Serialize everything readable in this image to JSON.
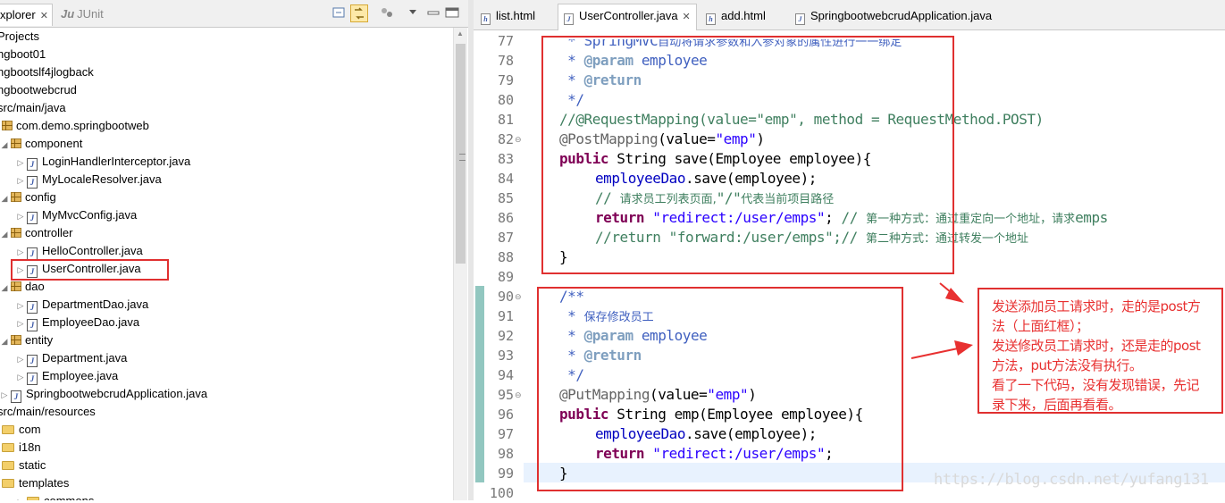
{
  "explorer": {
    "tab_label": "xplorer",
    "junit_label": "JUnit",
    "junit_icon": "Ju",
    "rows": [
      "Projects",
      "ngboot01",
      "ngbootslf4jlogback",
      "ngbootwebcrud",
      "src/main/java",
      "com.demo.springbootweb",
      "component",
      "LoginHandlerInterceptor.java",
      "MyLocaleResolver.java",
      "config",
      "MyMvcConfig.java",
      "controller",
      "HelloController.java",
      "UserController.java",
      "dao",
      "DepartmentDao.java",
      "EmployeeDao.java",
      "entity",
      "Department.java",
      "Employee.java",
      "SpringbootwebcrudApplication.java",
      "src/main/resources",
      "com",
      "i18n",
      "static",
      "templates",
      "commons"
    ]
  },
  "editor": {
    "tabs": [
      "list.html",
      "UserController.java",
      "add.html",
      "SpringbootwebcrudApplication.java"
    ],
    "line_numbers": [
      "77",
      "78",
      "79",
      "80",
      "81",
      "82",
      "83",
      "84",
      "85",
      "86",
      "87",
      "88",
      "89",
      "90",
      "91",
      "92",
      "93",
      "94",
      "95",
      "96",
      "97",
      "98",
      "99",
      "100"
    ],
    "code": {
      "l77a": " * SpringMVC",
      "l77b": "自动将请求参数和入参对象的属性进行一一绑定",
      "l78a": " * ",
      "l78b": "@param",
      "l78c": " employee",
      "l79a": " * ",
      "l79b": "@return",
      "l80": " */",
      "l81": "//@RequestMapping(value=\"emp\", method = RequestMethod.POST)",
      "l82a": "@PostMapping",
      "l82b": "(value=",
      "l82c": "\"emp\"",
      "l82d": ")",
      "l83a": "public",
      "l83b": " String save(Employee employee){",
      "l84a": "employeeDao",
      "l84b": ".save(employee);",
      "l85a": "// ",
      "l85b": "请求员工列表页面,",
      "l85c": "\"/\"",
      "l85d": "代表当前项目路径",
      "l86a": "return",
      "l86b": " \"redirect:/user/emps\"",
      "l86c": "; ",
      "l86d": "// ",
      "l86e": "第一种方式：通过重定向一个地址，请求",
      "l86f": "emps",
      "l87a": "//return \"forward:/user/emps\";// ",
      "l87b": "第二种方式：通过转发一个地址",
      "l88": "}",
      "l90": "/**",
      "l91a": " * ",
      "l91b": "保存修改员工",
      "l92a": " * ",
      "l92b": "@param",
      "l92c": " employee",
      "l93a": " * ",
      "l93b": "@return",
      "l94": " */",
      "l95a": "@PutMapping",
      "l95b": "(value=",
      "l95c": "\"emp\"",
      "l95d": ")",
      "l96a": "public",
      "l96b": " String emp(Employee employee){",
      "l97a": "employeeDao",
      "l97b": ".save(employee);",
      "l98a": "return",
      "l98b": " \"redirect:/user/emps\"",
      "l98c": ";",
      "l99": "}"
    }
  },
  "annotation": {
    "lines": [
      "发送添加员工请求时，走的是post方",
      "法（上面红框）；",
      "发送修改员工请求时，还是走的post",
      "方法，put方法没有执行。",
      "看了一下代码，没有发现错误，先记",
      "录下来，后面再看看。"
    ],
    "color": "#e83030"
  },
  "watermark": "https://blog.csdn.net/yufang131"
}
